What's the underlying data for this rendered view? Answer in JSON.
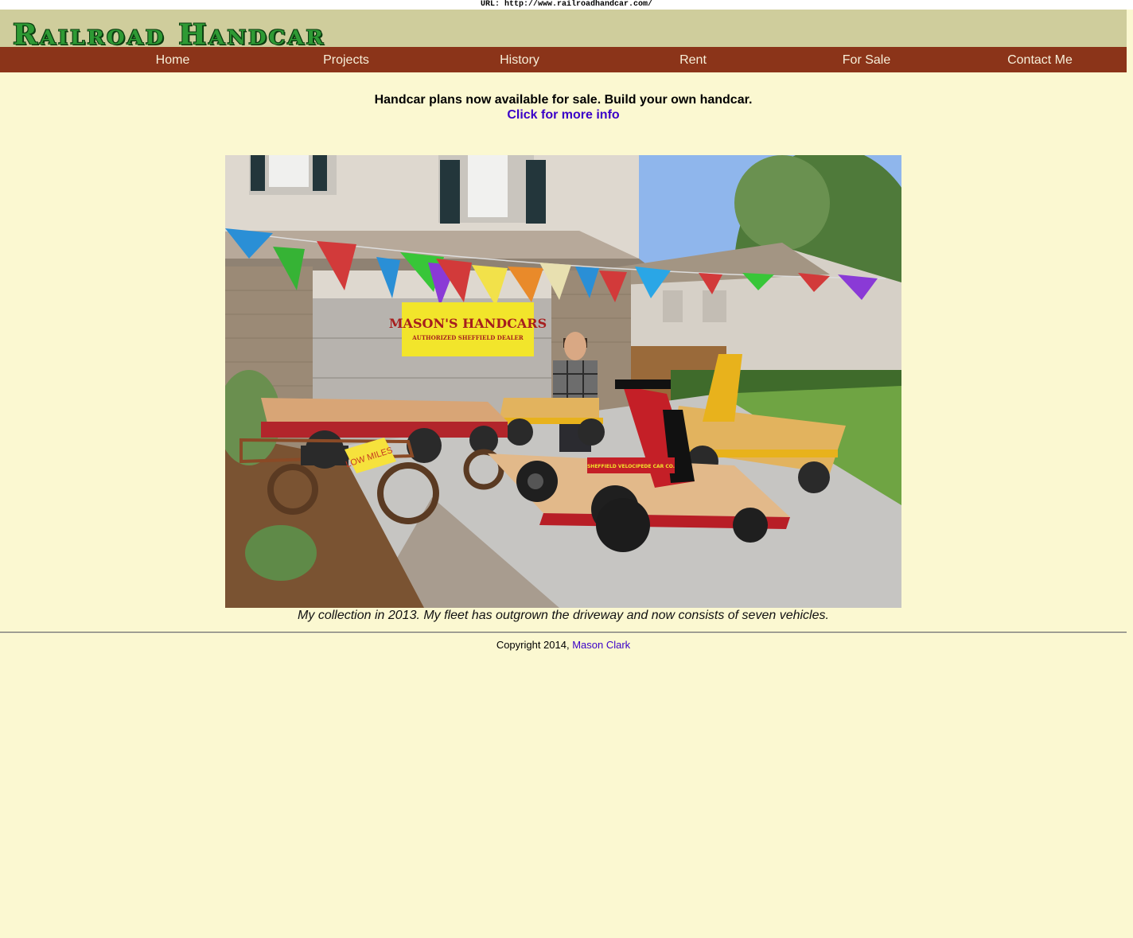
{
  "browser": {
    "url_text": "URL: http://www.railroadhandcar.com/"
  },
  "header": {
    "logo_text": "Railroad Handcar"
  },
  "nav": {
    "items": [
      {
        "label": "Home"
      },
      {
        "label": "Projects"
      },
      {
        "label": "History"
      },
      {
        "label": "Rent"
      },
      {
        "label": "For Sale"
      },
      {
        "label": "Contact Me"
      }
    ]
  },
  "announcement": {
    "text": "Handcar plans now available for sale. Build your own handcar.",
    "link_text": "Click for more info"
  },
  "photo": {
    "banner_title": "MASON'S HANDCARS",
    "banner_subtitle": "AUTHORIZED SHEFFIELD DEALER",
    "sign_text": "LOW MILES",
    "handcar_lettering": "SHEFFIELD VELOCIPEDE CAR CO.",
    "caption": "My collection in 2013. My fleet has outgrown the driveway and now consists of seven vehicles."
  },
  "footer": {
    "copyright": "Copyright 2014,",
    "author_link": "Mason Clark"
  },
  "colors": {
    "page_background": "#fbf8d1",
    "banner_background": "#cfcd9c",
    "nav_background": "#8b3419",
    "logo_green": "#2e9a34",
    "link_color": "#3a00c8"
  }
}
